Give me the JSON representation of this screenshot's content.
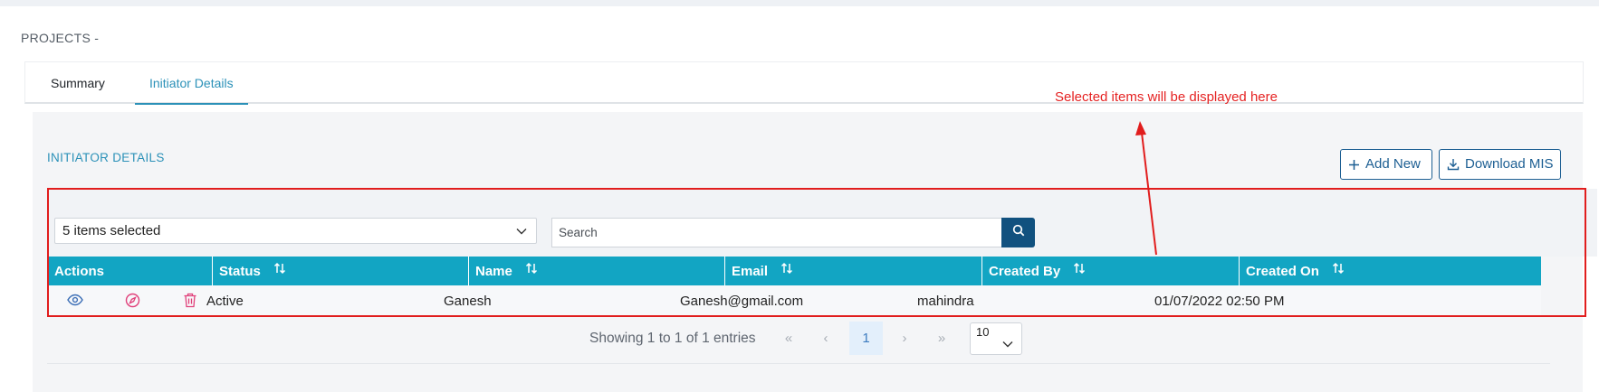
{
  "page": {
    "title": "PROJECTS -"
  },
  "tabs": [
    {
      "label": "Summary",
      "active": false
    },
    {
      "label": "Initiator Details",
      "active": true
    }
  ],
  "annotation": {
    "text": "Selected items will be displayed here",
    "color": "#e52222"
  },
  "section": {
    "title": "INITIATOR DETAILS"
  },
  "toolbar": {
    "add_label": "Add New",
    "add_icon": "plus-icon",
    "download_label": "Download MIS",
    "download_icon": "download-icon"
  },
  "filter": {
    "selected_label": "5 items selected",
    "search_placeholder": "Search"
  },
  "table": {
    "columns": [
      {
        "label": "Actions",
        "sortable": false
      },
      {
        "label": "Status",
        "sortable": true
      },
      {
        "label": "Name",
        "sortable": true
      },
      {
        "label": "Email",
        "sortable": true
      },
      {
        "label": "Created By",
        "sortable": true
      },
      {
        "label": "Created On",
        "sortable": true
      }
    ],
    "rows": [
      {
        "actions": [
          "view-icon",
          "compass-icon",
          "trash-icon"
        ],
        "status": "Active",
        "name": "Ganesh",
        "email": "Ganesh@gmail.com",
        "created_by": "mahindra",
        "created_on": "01/07/2022 02:50 PM"
      }
    ]
  },
  "pagination": {
    "summary": "Showing 1 to 1 of 1 entries",
    "first": "«",
    "prev": "‹",
    "current_page": "1",
    "next": "›",
    "last": "»",
    "page_size": "10"
  },
  "colors": {
    "accent": "#2b91b8",
    "header_bg": "#12a5c3",
    "button_border": "#1d5f93",
    "search_button": "#11517f",
    "annotation_red": "#e11d1d"
  }
}
